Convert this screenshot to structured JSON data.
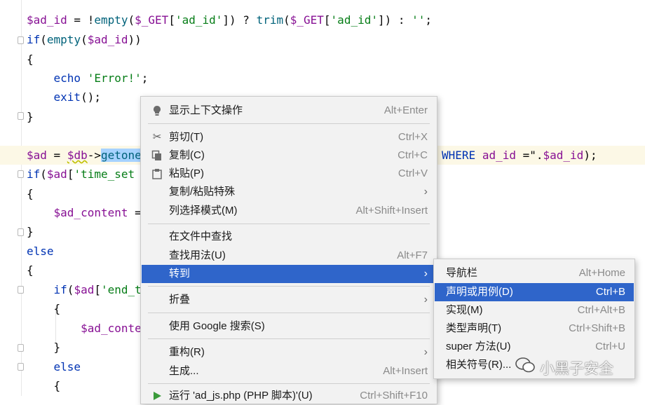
{
  "code_lines": [
    "$ad_id = !empty($_GET['ad_id']) ? trim($_GET['ad_id']) : '';",
    "if(empty($ad_id))",
    "{",
    "    echo 'Error!';",
    "    exit();",
    "}",
    "",
    "$ad = $db->getone",
    "if($ad['time_set",
    "{",
    "    $ad_content =",
    "}",
    "else",
    "{",
    "    if($ad['end_t",
    "    {",
    "        $ad_conte",
    "    }",
    "    else",
    "    {"
  ],
  "code_tail_line8": " WHERE ad_id =\".$ad_id);",
  "context_menu": {
    "items": [
      {
        "icon": "bulb-icon",
        "label": "显示上下文操作",
        "shortcut": "Alt+Enter"
      },
      {
        "icon": "scissors-icon",
        "label": "剪切(T)",
        "shortcut": "Ctrl+X"
      },
      {
        "icon": "copy-icon",
        "label": "复制(C)",
        "shortcut": "Ctrl+C"
      },
      {
        "icon": "paste-icon",
        "label": "粘贴(P)",
        "shortcut": "Ctrl+V"
      },
      {
        "icon": "",
        "label": "复制/粘贴特殊",
        "shortcut": "",
        "submenu": true
      },
      {
        "icon": "",
        "label": "列选择模式(M)",
        "shortcut": "Alt+Shift+Insert"
      },
      {
        "icon": "",
        "label": "在文件中查找",
        "shortcut": ""
      },
      {
        "icon": "",
        "label": "查找用法(U)",
        "shortcut": "Alt+F7"
      },
      {
        "icon": "",
        "label": "转到",
        "shortcut": "",
        "submenu": true,
        "active": true
      },
      {
        "icon": "",
        "label": "折叠",
        "shortcut": "",
        "submenu": true
      },
      {
        "icon": "",
        "label": "使用 Google 搜索(S)",
        "shortcut": ""
      },
      {
        "icon": "",
        "label": "重构(R)",
        "shortcut": "",
        "submenu": true
      },
      {
        "icon": "",
        "label": "生成...",
        "shortcut": "Alt+Insert"
      },
      {
        "icon": "run-icon",
        "label": "运行 'ad_js.php (PHP 脚本)'(U)",
        "shortcut": "Ctrl+Shift+F10"
      }
    ]
  },
  "goto_submenu": {
    "items": [
      {
        "label": "导航栏",
        "shortcut": "Alt+Home"
      },
      {
        "label": "声明或用例(D)",
        "shortcut": "Ctrl+B",
        "active": true
      },
      {
        "label": "实现(M)",
        "shortcut": "Ctrl+Alt+B"
      },
      {
        "label": "类型声明(T)",
        "shortcut": "Ctrl+Shift+B"
      },
      {
        "label": "super 方法(U)",
        "shortcut": "Ctrl+U"
      },
      {
        "label": "相关符号(R)...",
        "shortcut": ""
      }
    ]
  },
  "watermark": "小黑子安全",
  "colors": {
    "menu_active": "#2f65ca",
    "selection": "#a6d2ff",
    "caret_row": "#fcf8e6"
  }
}
